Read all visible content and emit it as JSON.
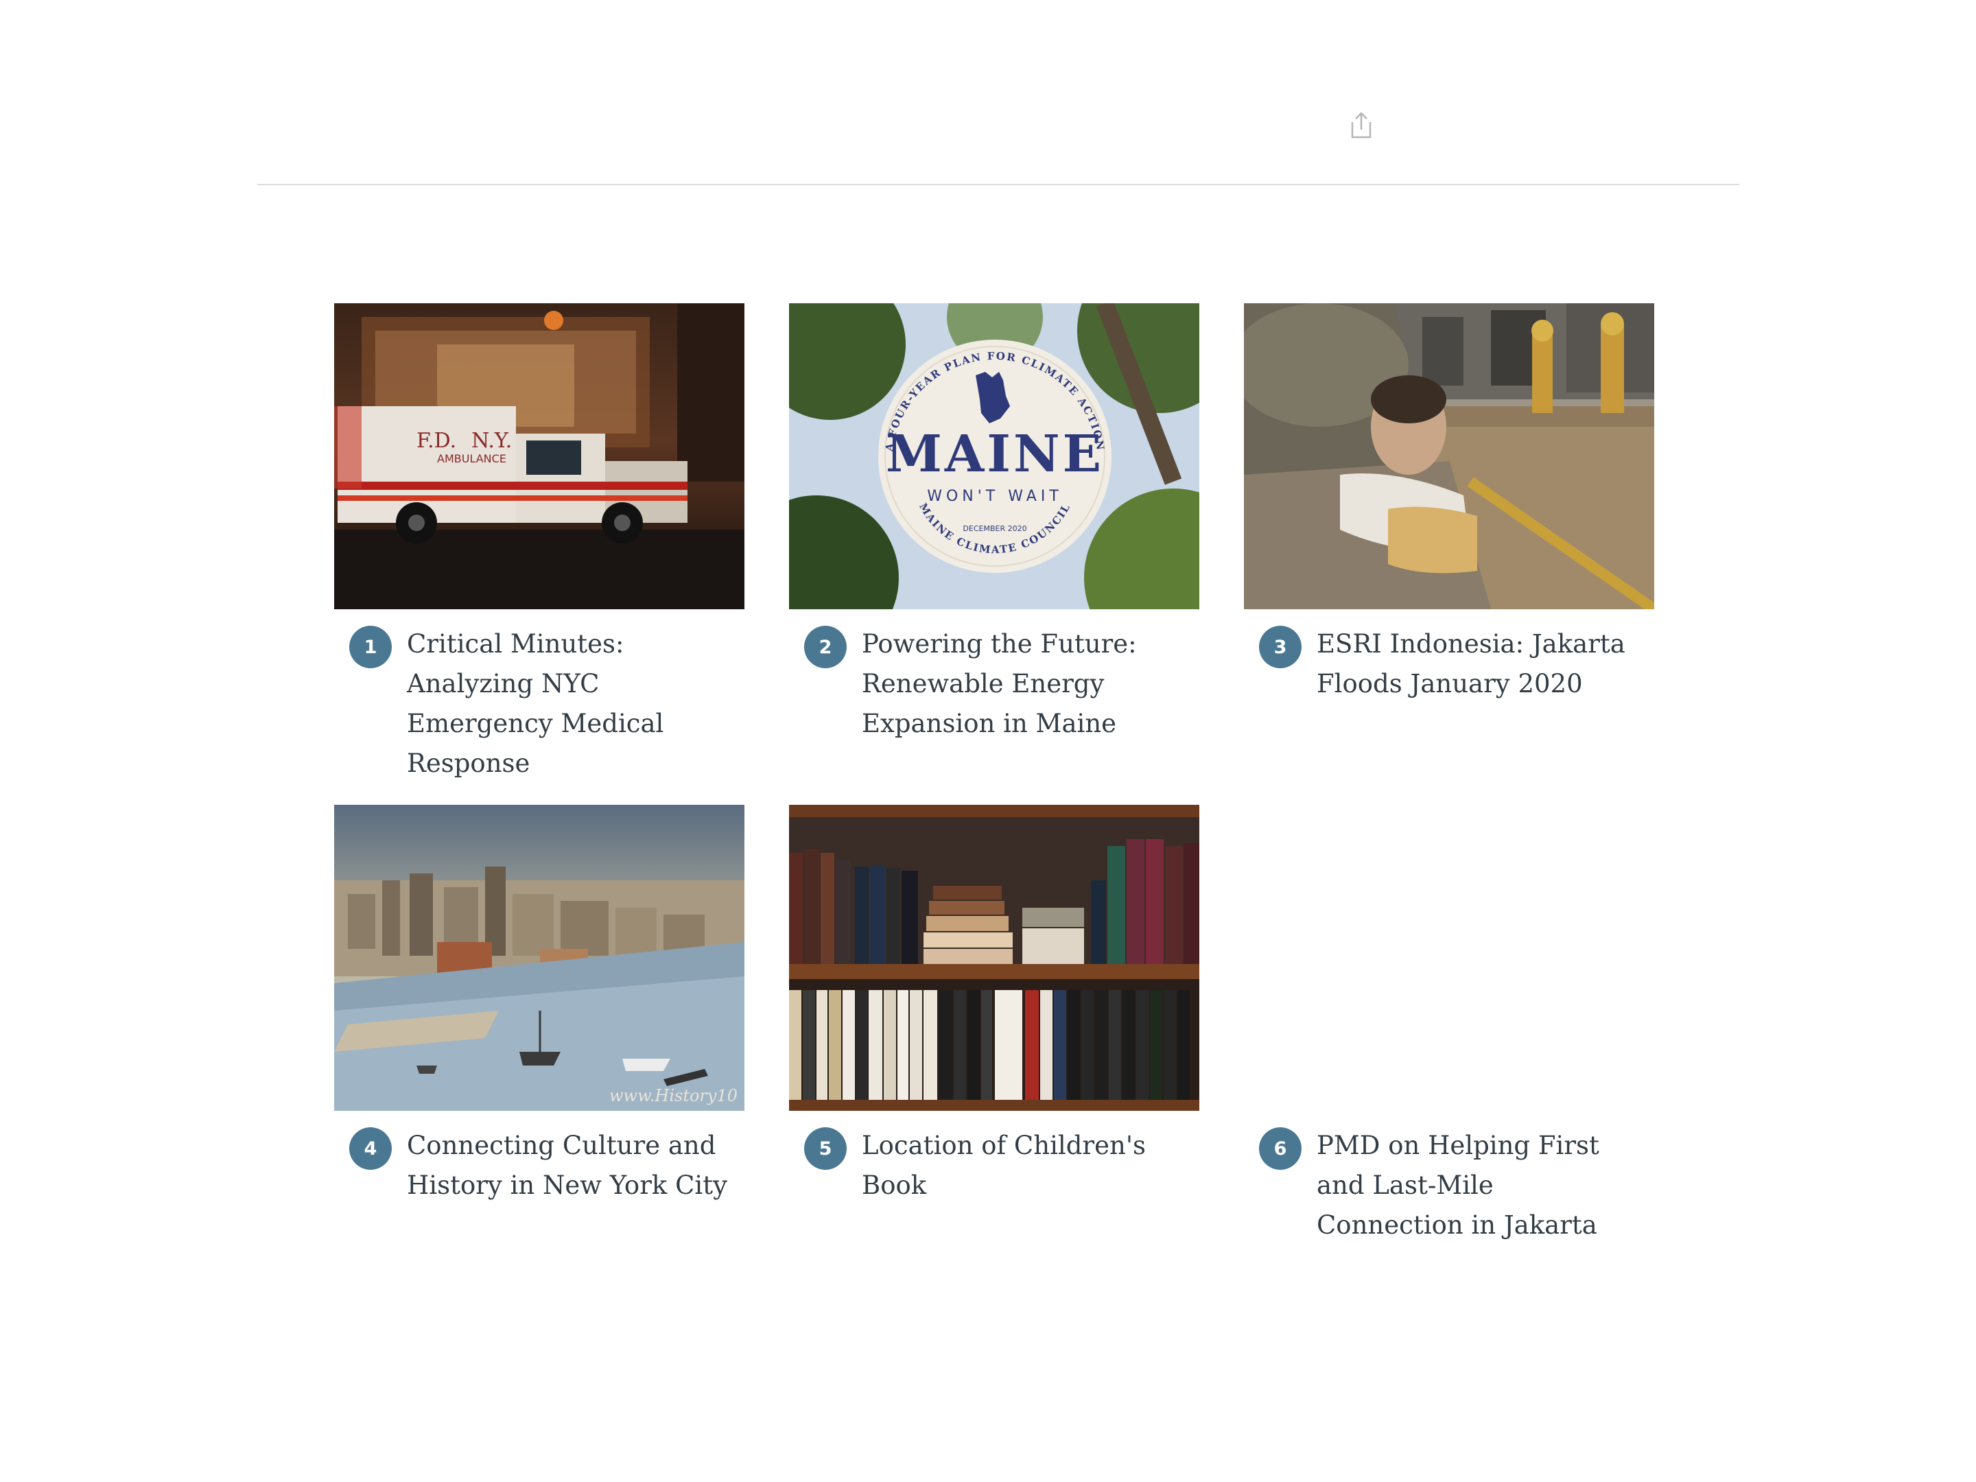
{
  "header": {
    "share_icon": "share-icon"
  },
  "colors": {
    "badge": "#4a7893",
    "title_text": "#333d45",
    "divider": "#dcdcdc"
  },
  "items": [
    {
      "number": "1",
      "title": "Critical Minutes: Analyzing NYC Emergency Medical Response",
      "image": "ambulance-photo"
    },
    {
      "number": "2",
      "title": "Powering the Future: Renewable Energy Expansion in Maine",
      "image": "maine-climate-logo",
      "logo_text": {
        "ring_top": "A FOUR-YEAR PLAN FOR CLIMATE ACTION",
        "main": "MAINE",
        "sub": "WON'T WAIT",
        "date": "DECEMBER 2020",
        "ring_bottom": "MAINE CLIMATE COUNCIL"
      }
    },
    {
      "number": "3",
      "title": "ESRI Indonesia: Jakarta Floods January 2020",
      "image": "flood-photo"
    },
    {
      "number": "4",
      "title": "Connecting Culture and History in New York City",
      "image": "nyc-engraving",
      "watermark": "www.History10"
    },
    {
      "number": "5",
      "title": "Location of Children's Book",
      "image": "bookshelf-photo"
    },
    {
      "number": "6",
      "title": "PMD on Helping First and Last-Mile Connection in Jakarta",
      "image": ""
    }
  ]
}
